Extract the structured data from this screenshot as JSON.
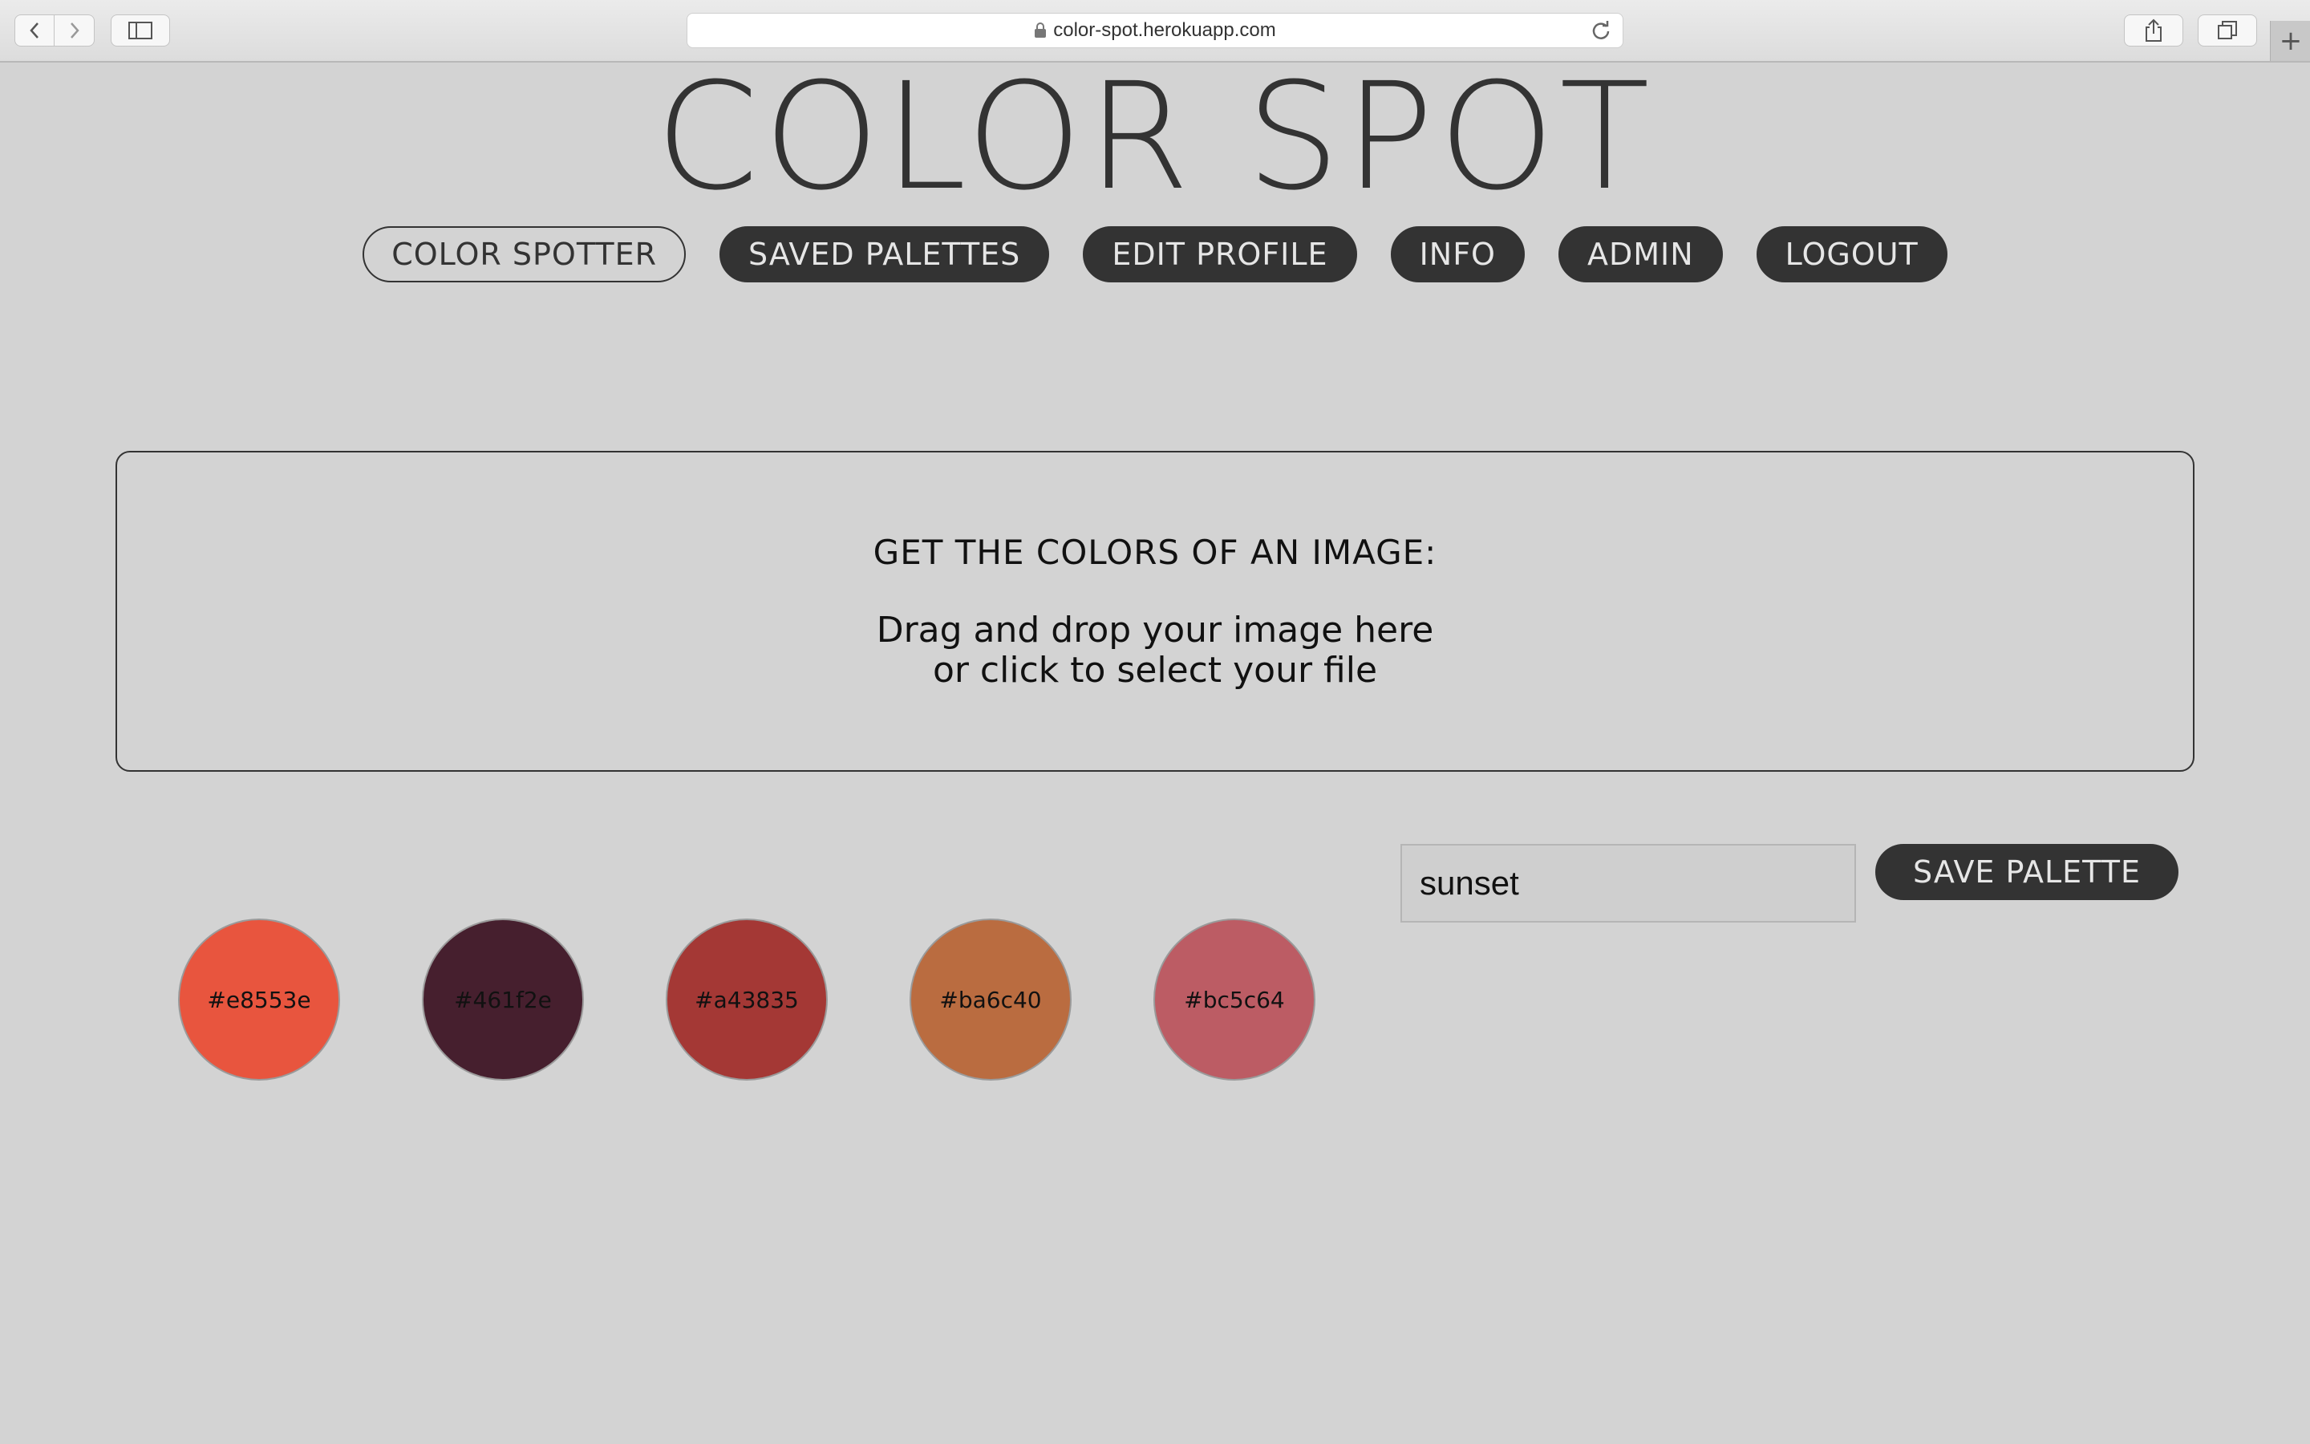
{
  "browser": {
    "url": "color-spot.herokuapp.com"
  },
  "site": {
    "title": "COLOR SPOT"
  },
  "nav": {
    "items": [
      {
        "label": "COLOR SPOTTER"
      },
      {
        "label": "SAVED PALETTES"
      },
      {
        "label": "EDIT PROFILE"
      },
      {
        "label": "INFO"
      },
      {
        "label": "ADMIN"
      },
      {
        "label": "LOGOUT"
      }
    ]
  },
  "dropzone": {
    "heading": "GET THE COLORS OF AN IMAGE:",
    "line1": "Drag and drop your image here",
    "line2": "or click to select your file"
  },
  "palette_form": {
    "name_value": "sunset",
    "save_label": "SAVE PALETTE"
  },
  "swatches": [
    {
      "hex": "#e8553e"
    },
    {
      "hex": "#461f2e"
    },
    {
      "hex": "#a43835"
    },
    {
      "hex": "#ba6c40"
    },
    {
      "hex": "#bc5c64"
    }
  ]
}
